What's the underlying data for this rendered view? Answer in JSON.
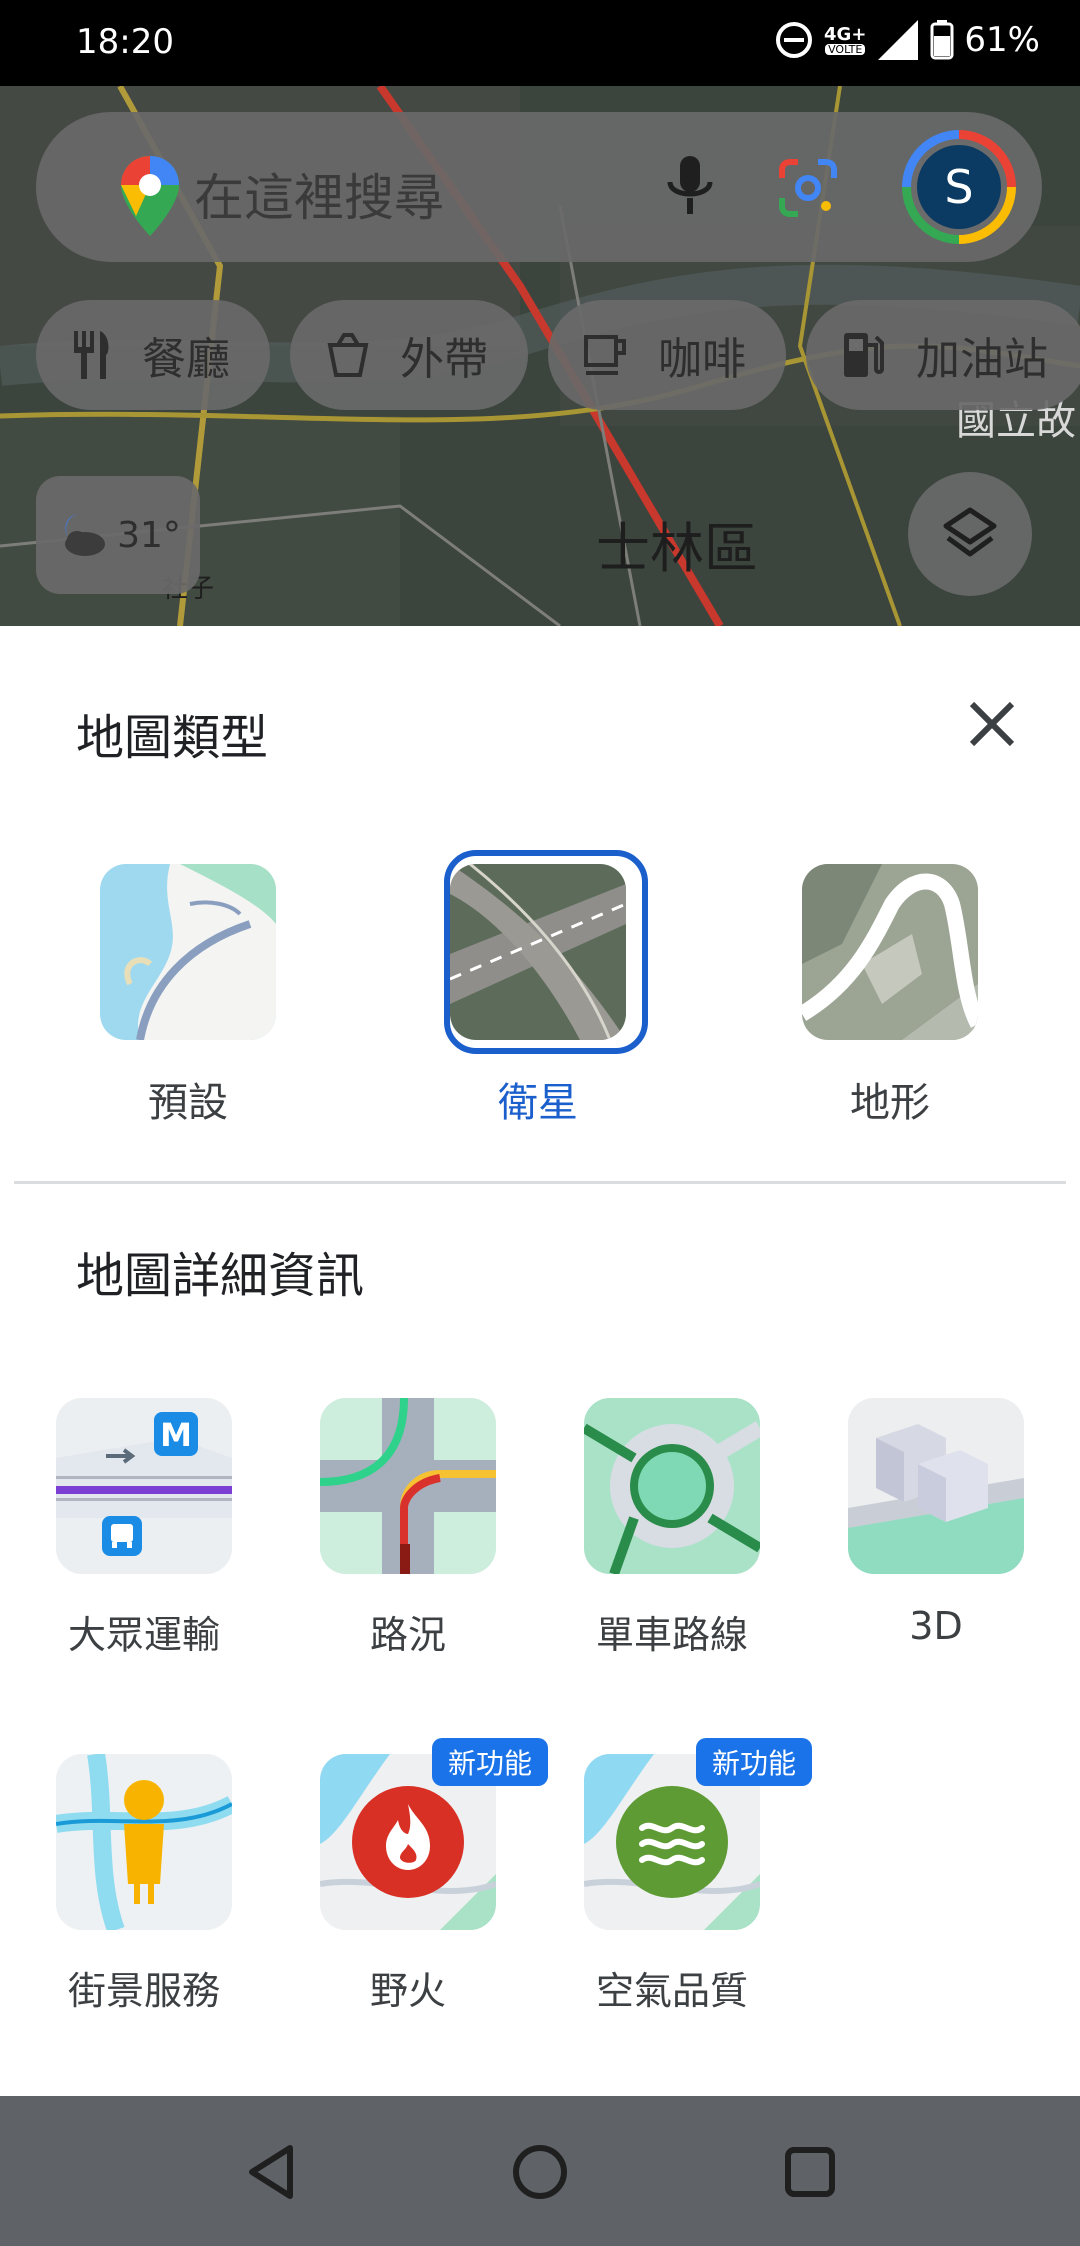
{
  "status_bar": {
    "time": "18:20",
    "network": "4G+",
    "volte": "VOLTE",
    "battery": "61%"
  },
  "map": {
    "search_placeholder": "在這裡搜尋",
    "avatar_letter": "S",
    "chips": [
      {
        "icon": "restaurant-icon",
        "label": "餐廳"
      },
      {
        "icon": "takeout-icon",
        "label": "外帶"
      },
      {
        "icon": "coffee-icon",
        "label": "咖啡"
      },
      {
        "icon": "gas-station-icon",
        "label": "加油站"
      }
    ],
    "weather": {
      "icon": "night-cloud-icon",
      "temp": "31°"
    },
    "labels": {
      "district": "士林區",
      "top_right": "國立故",
      "left_small": "社子"
    }
  },
  "sheet": {
    "map_type_title": "地圖類型",
    "map_types": [
      {
        "label": "預設",
        "selected": false
      },
      {
        "label": "衛星",
        "selected": true
      },
      {
        "label": "地形",
        "selected": false
      }
    ],
    "map_details_title": "地圖詳細資訊",
    "map_details": [
      {
        "label": "大眾運輸",
        "badge": ""
      },
      {
        "label": "路況",
        "badge": ""
      },
      {
        "label": "單車路線",
        "badge": ""
      },
      {
        "label": "3D",
        "badge": ""
      },
      {
        "label": "街景服務",
        "badge": ""
      },
      {
        "label": "野火",
        "badge": "新功能"
      },
      {
        "label": "空氣品質",
        "badge": "新功能"
      }
    ]
  },
  "colors": {
    "accent": "#1a5fcc",
    "badge": "#1a73e8"
  }
}
